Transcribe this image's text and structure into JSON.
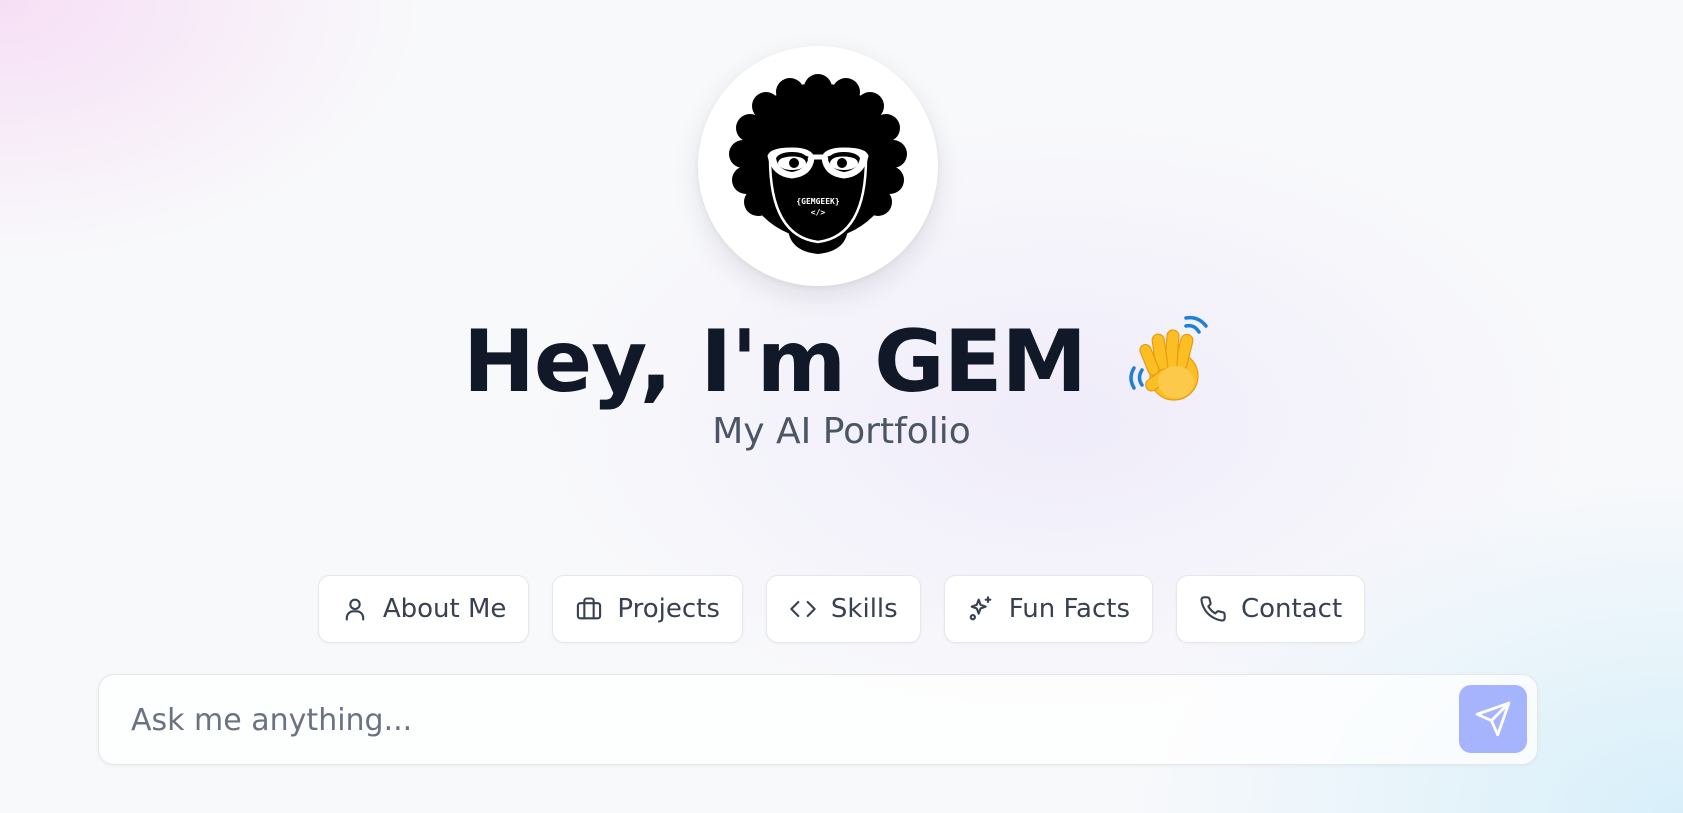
{
  "avatar": {
    "badge_line1": "{GEMGEEK}",
    "badge_line2": "</>"
  },
  "hero": {
    "title": "Hey, I'm GEM",
    "wave_icon": "waving-hand-emoji",
    "subtitle": "My AI Portfolio"
  },
  "quick_actions": [
    {
      "label": "About Me",
      "icon": "user-icon"
    },
    {
      "label": "Projects",
      "icon": "briefcase-icon"
    },
    {
      "label": "Skills",
      "icon": "code-icon"
    },
    {
      "label": "Fun Facts",
      "icon": "sparkles-icon"
    },
    {
      "label": "Contact",
      "icon": "phone-icon"
    }
  ],
  "chat": {
    "placeholder": "Ask me anything...",
    "send_icon": "send-icon"
  },
  "colors": {
    "title": "#111827",
    "subtitle": "#4b5563",
    "send_button": "#a5b4fc",
    "chip_border": "#e5e7eb"
  }
}
